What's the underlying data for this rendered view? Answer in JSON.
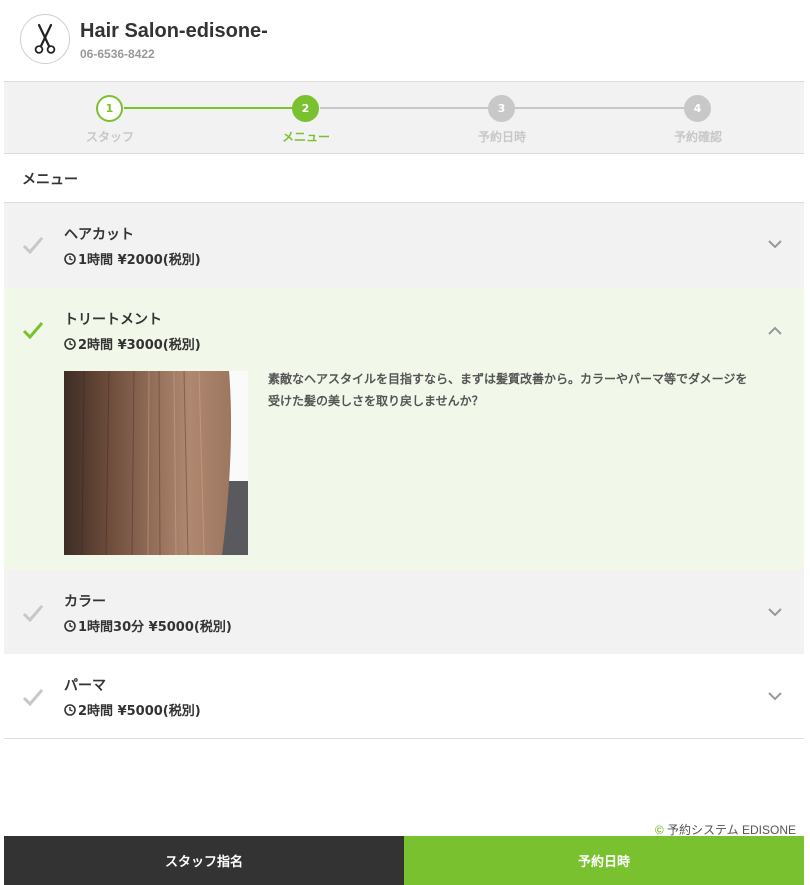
{
  "header": {
    "salon_name": "Hair Salon-edisone-",
    "phone": "06-6536-8422",
    "logo_icon": "scissors-icon"
  },
  "steps": [
    {
      "number": "1",
      "label": "スタッフ",
      "state": "done"
    },
    {
      "number": "2",
      "label": "メニュー",
      "state": "current"
    },
    {
      "number": "3",
      "label": "予約日時",
      "state": "upcoming"
    },
    {
      "number": "4",
      "label": "予約確認",
      "state": "upcoming"
    }
  ],
  "section": {
    "title": "メニュー"
  },
  "menu": [
    {
      "name": "ヘアカット",
      "meta": "1時間 ¥2000(税別)",
      "selected": false,
      "expanded": false
    },
    {
      "name": "トリートメント",
      "meta": "2時間 ¥3000(税別)",
      "selected": true,
      "expanded": true,
      "description": "素敵なヘアスタイルを目指すなら、まずは髪質改善から。カラーやパーマ等でダメージを受けた髪の美しさを取り戻しませんか？"
    },
    {
      "name": "カラー",
      "meta": "1時間30分 ¥5000(税別)",
      "selected": false,
      "expanded": false
    },
    {
      "name": "パーマ",
      "meta": "2時間 ¥5000(税別)",
      "selected": false,
      "expanded": false
    }
  ],
  "footer": {
    "copyright_symbol": "©",
    "copyright": "予約システム EDISONE",
    "back_button": "スタッフ指名",
    "next_button": "予約日時"
  },
  "colors": {
    "accent": "#7ac12f",
    "inactive": "#c8c8c8",
    "selected_bg": "#f1f8e9",
    "unselected_bg": "#f2f2f2",
    "dark": "#333333"
  }
}
